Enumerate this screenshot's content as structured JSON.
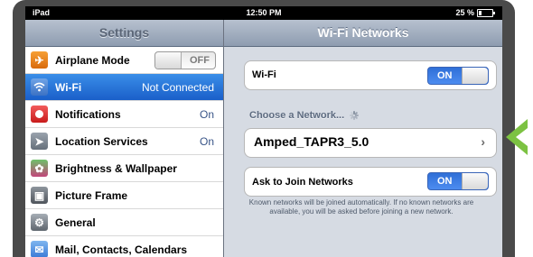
{
  "statusbar": {
    "device": "iPad",
    "time": "12:50 PM",
    "battery": "25 %"
  },
  "settings": {
    "title": "Settings",
    "items": [
      {
        "label": "Airplane Mode",
        "icon": "airplane-icon",
        "switch": "OFF"
      },
      {
        "label": "Wi-Fi",
        "value": "Not Connected",
        "icon": "wifi-icon"
      },
      {
        "label": "Notifications",
        "value": "On",
        "icon": "notifications-icon"
      },
      {
        "label": "Location Services",
        "value": "On",
        "icon": "location-icon"
      },
      {
        "label": "Brightness & Wallpaper",
        "icon": "brightness-icon"
      },
      {
        "label": "Picture Frame",
        "icon": "picture-frame-icon"
      },
      {
        "label": "General",
        "icon": "gear-icon"
      },
      {
        "label": "Mail, Contacts, Calendars",
        "icon": "mail-icon"
      }
    ]
  },
  "wifi": {
    "title": "Wi-Fi Networks",
    "wifi_label": "Wi-Fi",
    "wifi_switch": "ON",
    "choose_label": "Choose a Network...",
    "network_name": "Amped_TAPR3_5.0",
    "ask_label": "Ask to Join Networks",
    "ask_switch": "ON",
    "note": "Known networks will be joined automatically. If no known networks are available, you will be asked before joining a new network."
  },
  "colors": {
    "accent": "#7cc242",
    "selected": "#2a76dc"
  }
}
